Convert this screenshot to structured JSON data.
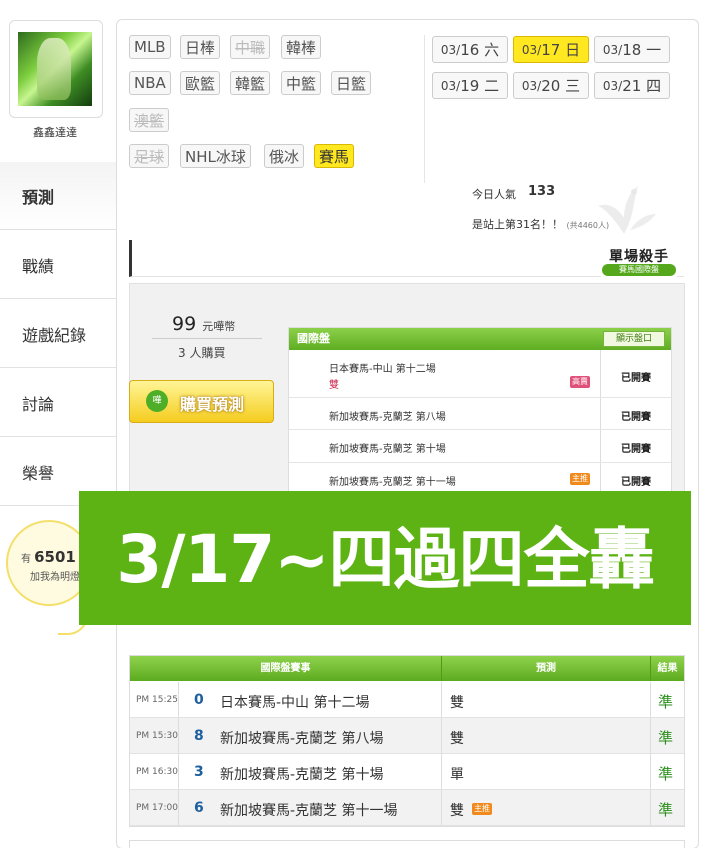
{
  "user": {
    "name": "鑫鑫達達"
  },
  "nav": [
    {
      "label": "預測",
      "active": true
    },
    {
      "label": "戰績"
    },
    {
      "label": "遊戲紀錄"
    },
    {
      "label": "討論"
    },
    {
      "label": "榮譽"
    }
  ],
  "lamp": {
    "prefix": "有",
    "count": "6501",
    "suffix": "人",
    "text": "加我為明燈"
  },
  "sports": [
    {
      "label": "MLB",
      "state": "normal"
    },
    {
      "label": "日棒",
      "state": "normal"
    },
    {
      "label": "中職",
      "state": "disabled"
    },
    {
      "label": "韓棒",
      "state": "normal"
    },
    {
      "label": "NBA",
      "state": "normal"
    },
    {
      "label": "歐籃",
      "state": "normal"
    },
    {
      "label": "韓籃",
      "state": "normal"
    },
    {
      "label": "中籃",
      "state": "normal"
    },
    {
      "label": "日籃",
      "state": "normal"
    },
    {
      "label": "澳籃",
      "state": "disabled"
    },
    {
      "label": "足球",
      "state": "disabled"
    },
    {
      "label": "NHL冰球",
      "state": "normal"
    },
    {
      "label": "俄冰",
      "state": "normal"
    },
    {
      "label": "賽馬",
      "state": "active"
    }
  ],
  "dates": [
    {
      "md": "03/",
      "d": "16",
      "w": "六",
      "active": false
    },
    {
      "md": "03/",
      "d": "17",
      "w": "日",
      "active": true
    },
    {
      "md": "03/",
      "d": "18",
      "w": "一",
      "active": false
    },
    {
      "md": "03/",
      "d": "19",
      "w": "二",
      "active": false
    },
    {
      "md": "03/",
      "d": "20",
      "w": "三",
      "active": false
    },
    {
      "md": "03/",
      "d": "21",
      "w": "四",
      "active": false
    }
  ],
  "stats": {
    "pop_label": "今日人氣",
    "pop_value": "133",
    "rank_text": "是站上第31名！！",
    "rank_total": "(共4460人)"
  },
  "killer": {
    "title": "單場殺手",
    "subtitle": "賽馬國際盤"
  },
  "purchase": {
    "price": "99",
    "price_unit": "元嘩幣",
    "buyers": "3 人購買",
    "buy_label": "購買預測",
    "buy_icon": "嘩"
  },
  "prediction": {
    "header": "國際盤",
    "show_button": "顯示盤口",
    "rows": [
      {
        "name": "日本賽馬-中山 第十二場",
        "pick": "雙",
        "badge": "高賣",
        "badge_color": "#e0517a",
        "status": "已開賽"
      },
      {
        "name": "新加坡賽馬-克蘭芝 第八場",
        "pick": "",
        "badge": "",
        "badge_color": "",
        "status": "已開賽"
      },
      {
        "name": "新加坡賽馬-克蘭芝 第十場",
        "pick": "",
        "badge": "",
        "badge_color": "",
        "status": "已開賽"
      },
      {
        "name": "新加坡賽馬-克蘭芝 第十一場",
        "pick": "",
        "badge": "主推",
        "badge_color": "#f08a1c",
        "status": "已開賽"
      }
    ]
  },
  "banner": {
    "text": "3/17~四過四全轟",
    "color": "#5db314"
  },
  "results": {
    "headers": {
      "game": "國際盤賽事",
      "pick": "預測",
      "result": "結果"
    },
    "rows": [
      {
        "time": "PM 15:25",
        "num": "0",
        "game": "日本賽馬-中山 第十二場",
        "pick": "雙",
        "badge": "",
        "result": "準"
      },
      {
        "time": "PM 15:30",
        "num": "8",
        "game": "新加坡賽馬-克蘭芝 第八場",
        "pick": "雙",
        "badge": "",
        "result": "準"
      },
      {
        "time": "PM 16:30",
        "num": "3",
        "game": "新加坡賽馬-克蘭芝 第十場",
        "pick": "單",
        "badge": "",
        "result": "準"
      },
      {
        "time": "PM 17:00",
        "num": "6",
        "game": "新加坡賽馬-克蘭芝 第十一場",
        "pick": "雙",
        "badge": "主推",
        "result": "準"
      }
    ]
  }
}
